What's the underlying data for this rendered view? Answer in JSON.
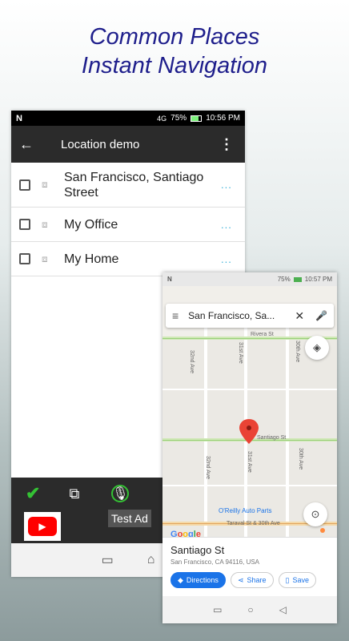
{
  "headline": {
    "line1": "Common Places",
    "line2": "Instant Navigation"
  },
  "phone1": {
    "status": {
      "n_icon": "N",
      "network": "4G",
      "battery_pct": "75%",
      "time": "10:56 PM"
    },
    "appbar": {
      "back_icon": "←",
      "title": "Location demo",
      "menu_icon": "⋮"
    },
    "places": [
      {
        "label_line1": "San Francisco, Santiago",
        "label_line2": "Street",
        "more": "..."
      },
      {
        "label_line1": "My Office",
        "label_line2": "",
        "more": "..."
      },
      {
        "label_line1": "My Home",
        "label_line2": "",
        "more": "..."
      }
    ],
    "toolbar": {
      "check_icon": "✔",
      "copy_icon": "⧉",
      "mic_icon": "🎙"
    },
    "ad": {
      "label": "Test Ad",
      "youtube_icon": "▶"
    },
    "nav": {
      "recents_icon": "▭",
      "home_icon": "⌂"
    }
  },
  "phone2": {
    "status": {
      "n_icon": "N",
      "battery_pct": "75%",
      "time": "10:57 PM"
    },
    "search": {
      "menu_icon": "≡",
      "text": "San Francisco, Sa...",
      "clear_icon": "✕",
      "mic_icon": "🎤"
    },
    "map": {
      "streets": {
        "rivera": "Rivera St",
        "santiago": "Santiago St",
        "taraval": "Taraval St & 30th Ave",
        "ave32": "32nd Ave",
        "ave31": "31st Ave",
        "ave30": "30th Ave",
        "ave32b": "32nd Ave",
        "ave31b": "31st Ave",
        "ave30b": "30th Ave"
      },
      "poi": "O'Reilly Auto Parts",
      "google_logo": [
        "G",
        "o",
        "o",
        "g",
        "l",
        "e"
      ],
      "logo_colors": [
        "#4285f4",
        "#ea4335",
        "#fbbc05",
        "#4285f4",
        "#34a853",
        "#ea4335"
      ],
      "layers_icon": "◈",
      "locate_icon": "⊙"
    },
    "place": {
      "name": "Santiago St",
      "address": "San Francisco, CA 94116, USA",
      "directions": "Directions",
      "share": "Share",
      "save": "Save",
      "directions_icon": "◆",
      "share_icon": "⋖",
      "save_icon": "▯"
    },
    "nav": {
      "recents_icon": "▭",
      "home_icon": "○",
      "back_icon": "◁"
    }
  }
}
